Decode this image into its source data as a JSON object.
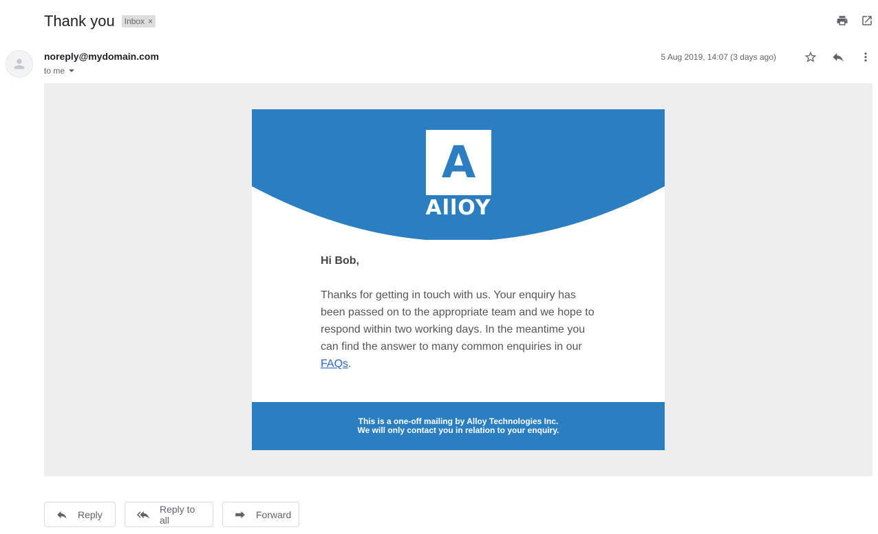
{
  "header": {
    "subject": "Thank you",
    "label_chip": "Inbox",
    "label_remove": "×",
    "print_icon": "print-icon",
    "open_new_window_icon": "open-in-new-window-icon"
  },
  "message": {
    "sender": "noreply@mydomain.com",
    "recipient": "to me",
    "date": "5 Aug 2019, 14:07 (3 days ago)",
    "avatar_icon": "person-icon",
    "star_icon": "star-outline-icon",
    "reply_icon": "reply-icon",
    "more_icon": "more-vertical-icon"
  },
  "email": {
    "brand_color": "#2b7fc1",
    "logo_letter": "A",
    "logo_word": "AllOY",
    "greeting": "Hi Bob,",
    "body": "Thanks for getting in touch with us. Your enquiry has been passed on to the appropriate team and we hope to respond within two working days. In the meantime you can find the answer to many common enquiries in our",
    "link_text": "FAQs",
    "after_link": ".",
    "footer_line1": "This is a one-off mailing by Alloy Technologies Inc.",
    "footer_line2": "We will only contact you in relation to your enquiry."
  },
  "actions": {
    "reply": "Reply",
    "reply_all": "Reply to all",
    "forward": "Forward"
  }
}
